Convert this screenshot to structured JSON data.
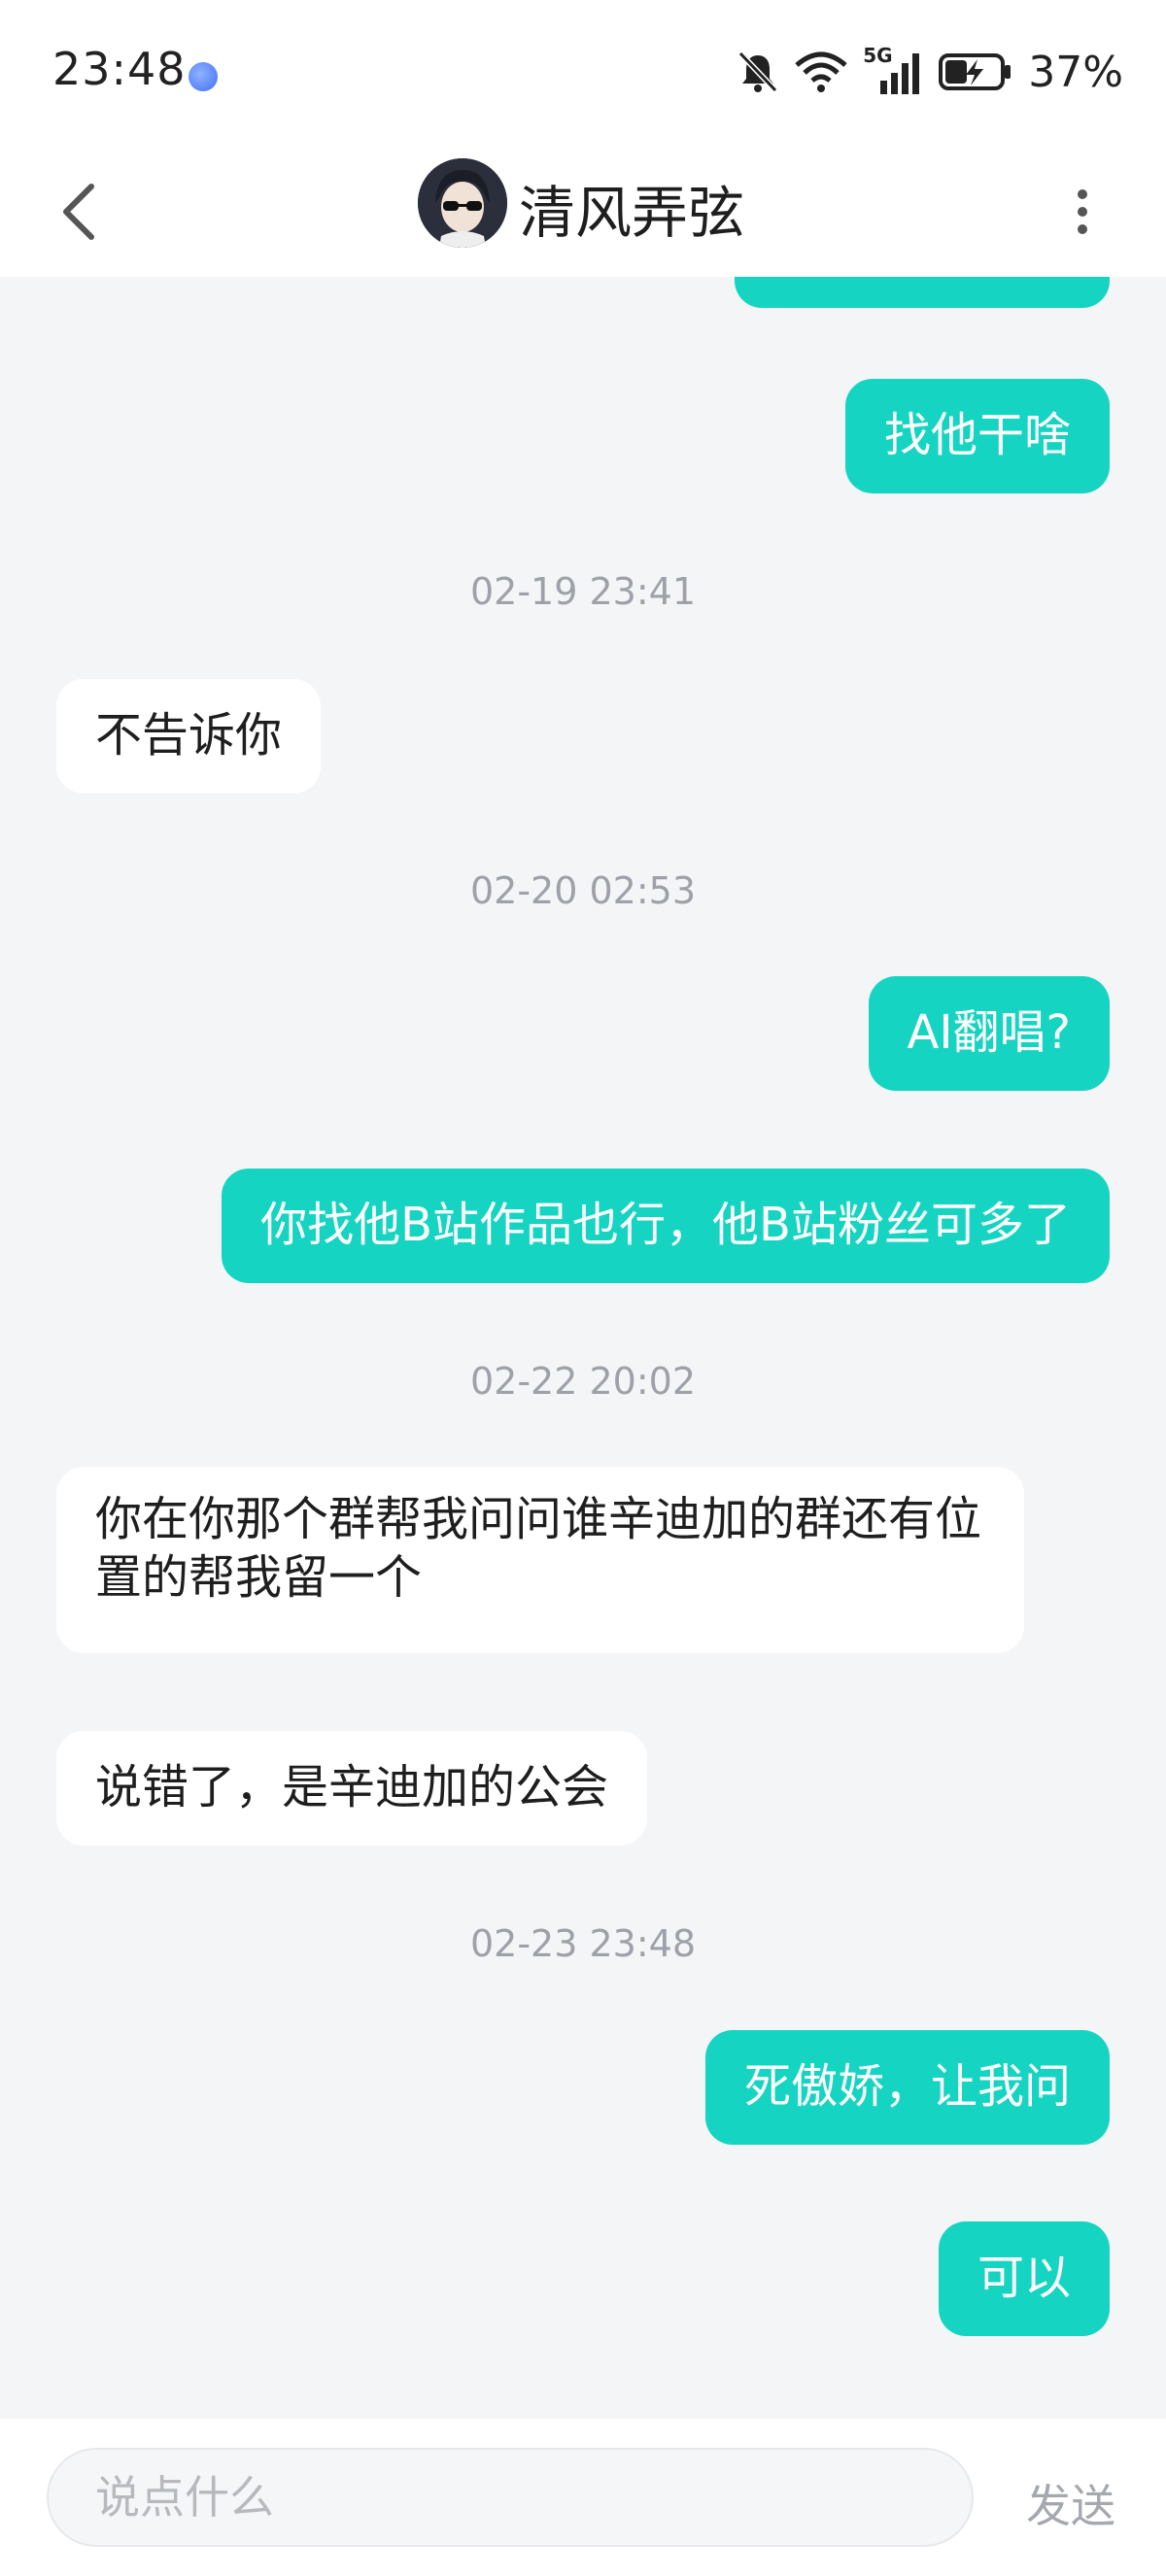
{
  "status": {
    "time": "23:48",
    "network": "5G",
    "battery": "37%"
  },
  "header": {
    "title": "清风弄弦"
  },
  "messages": [
    {
      "text": "找他干啥"
    },
    {
      "time": "02-19 23:41"
    },
    {
      "text": "不告诉你"
    },
    {
      "time": "02-20 02:53"
    },
    {
      "text": "AI翻唱?"
    },
    {
      "text": "你找他B站作品也行，他B站粉丝可多了"
    },
    {
      "time": "02-22 20:02"
    },
    {
      "text": "你在你那个群帮我问问谁辛迪加的群还有位置的帮我留一个"
    },
    {
      "text": "说错了，是辛迪加的公会"
    },
    {
      "time": "02-23 23:48"
    },
    {
      "text": "死傲娇，让我问"
    },
    {
      "text": "可以"
    }
  ],
  "input": {
    "placeholder": "说点什么",
    "send": "发送"
  },
  "colors": {
    "accent": "#16d4c2",
    "background": "#f4f5f7"
  }
}
